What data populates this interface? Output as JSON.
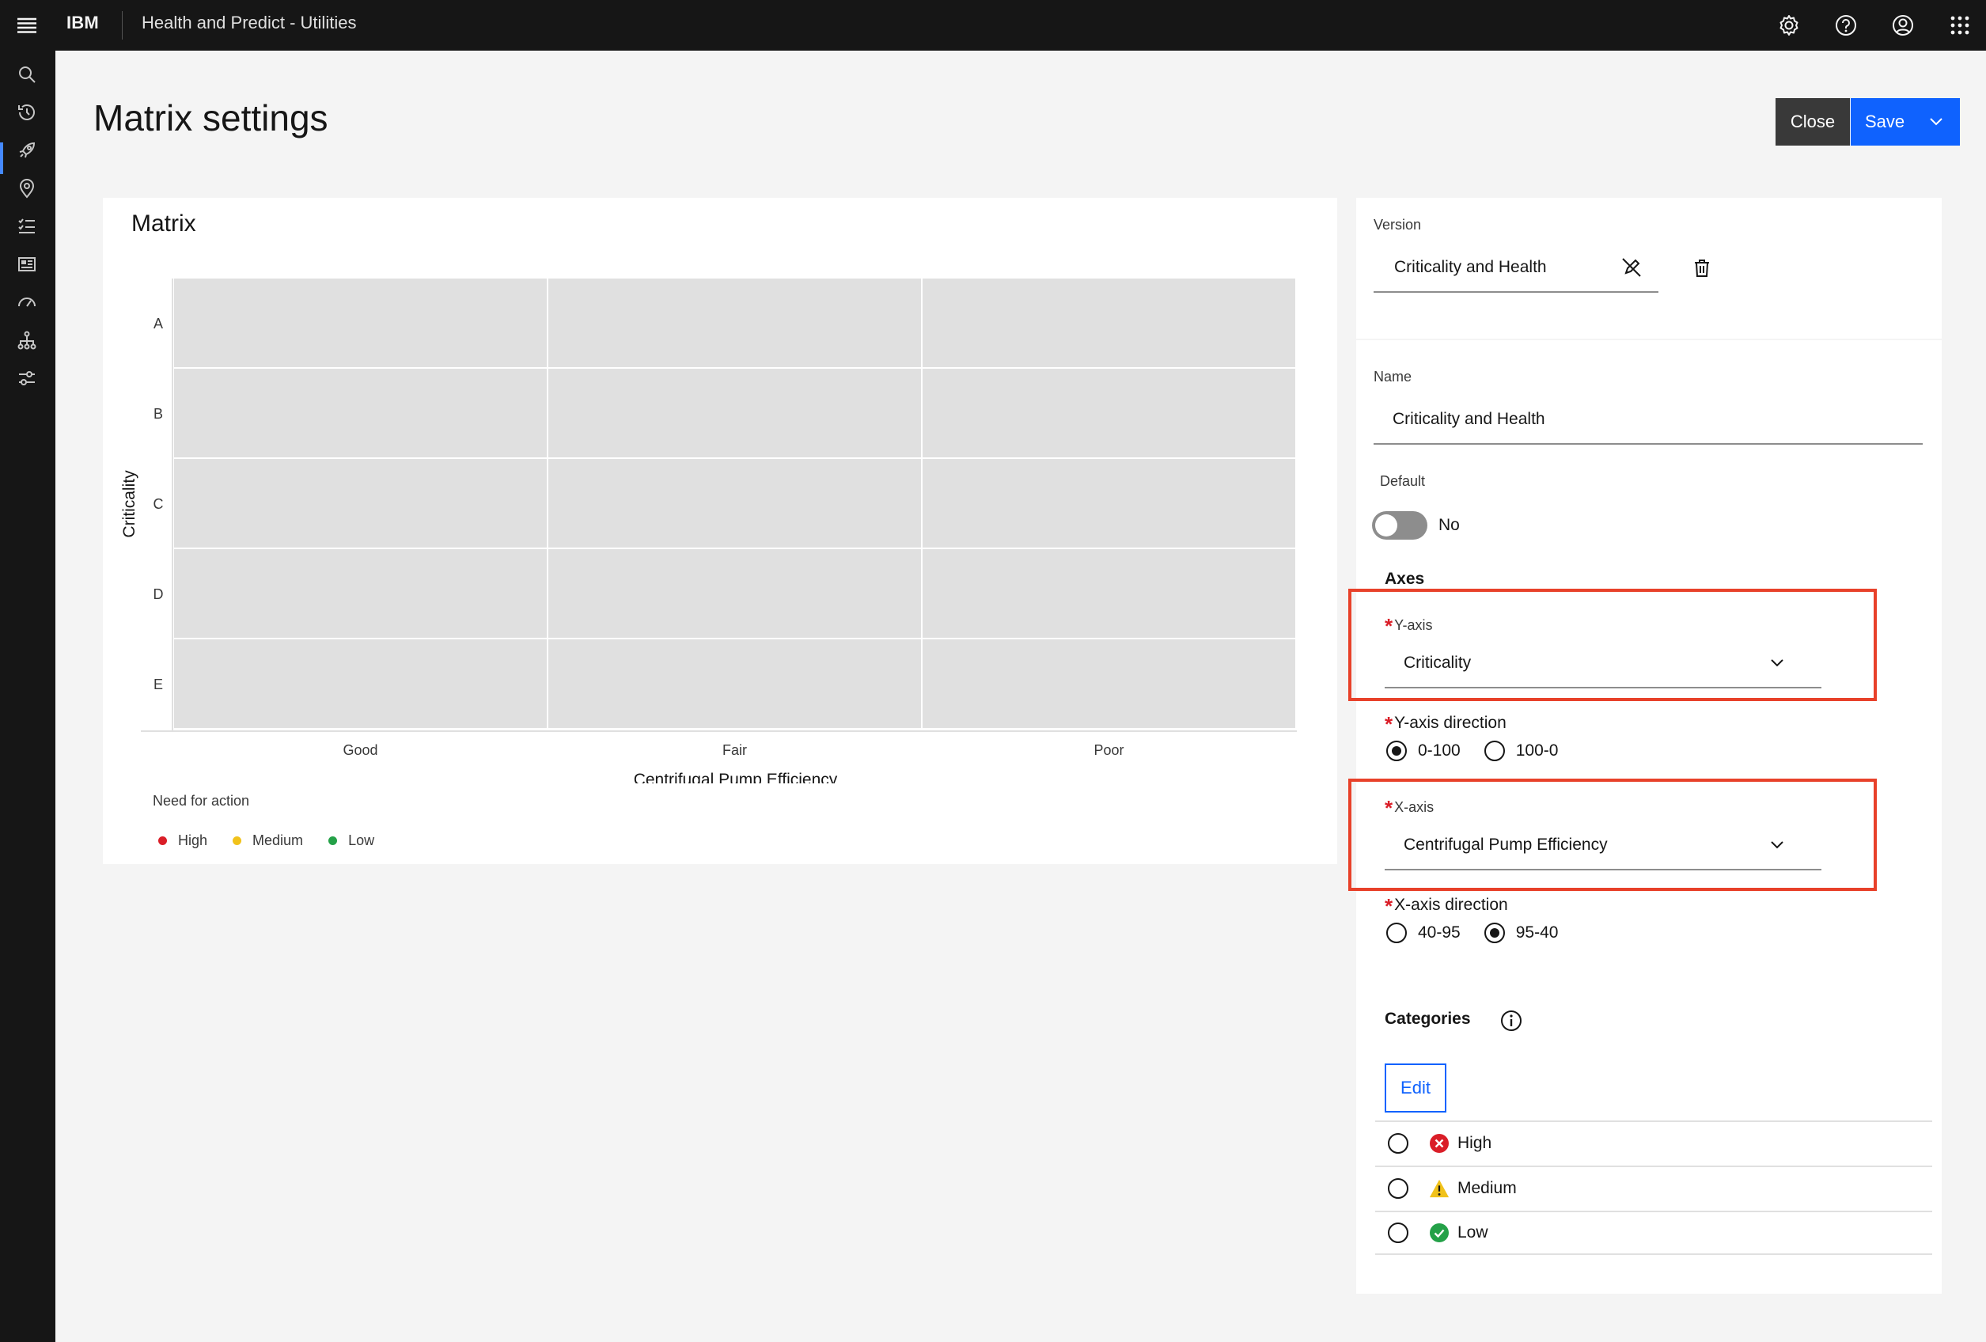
{
  "header": {
    "brand": "IBM",
    "app_name": "Health and Predict - Utilities",
    "icons": [
      "menu-icon",
      "settings-icon",
      "help-icon",
      "user-icon",
      "app-switcher-icon"
    ]
  },
  "left_nav": {
    "icons": [
      "search-icon",
      "history-icon",
      "rocket-icon",
      "location-icon",
      "checklist-icon",
      "dashboard-icon",
      "gauge-icon",
      "hierarchy-icon",
      "sliders-icon"
    ],
    "active_index": 2
  },
  "page": {
    "title": "Matrix settings",
    "close_label": "Close",
    "save_label": "Save"
  },
  "matrix": {
    "title": "Matrix",
    "legend_title": "Need for action",
    "legend": [
      {
        "label": "High",
        "color": "#da1e28"
      },
      {
        "label": "Medium",
        "color": "#f1c21b"
      },
      {
        "label": "Low",
        "color": "#24a148"
      }
    ]
  },
  "chart_data": {
    "type": "heatmap",
    "title": "Matrix",
    "xlabel": "Centrifugal Pump Efficiency",
    "ylabel": "Criticality",
    "x_categories": [
      "Good",
      "Fair",
      "Poor"
    ],
    "y_categories": [
      "A",
      "B",
      "C",
      "D",
      "E"
    ],
    "cell_color": "#e0e0e0",
    "values": []
  },
  "settings": {
    "version_label": "Version",
    "version_value": "Criticality and Health",
    "name_label": "Name",
    "name_value": "Criticality and Health",
    "default_label": "Default",
    "default_value": "No",
    "axes_heading": "Axes",
    "y_axis_label": "Y-axis",
    "y_axis_value": "Criticality",
    "y_direction_label": "Y-axis direction",
    "y_direction_options": [
      "0-100",
      "100-0"
    ],
    "y_direction_selected": "0-100",
    "x_axis_label": "X-axis",
    "x_axis_value": "Centrifugal Pump Efficiency",
    "x_direction_label": "X-axis direction",
    "x_direction_options": [
      "40-95",
      "95-40"
    ],
    "x_direction_selected": "95-40",
    "categories_heading": "Categories",
    "edit_label": "Edit",
    "categories": [
      {
        "label": "High",
        "icon": "error-icon",
        "color": "#da1e28"
      },
      {
        "label": "Medium",
        "icon": "warning-icon",
        "color": "#f1c21b"
      },
      {
        "label": "Low",
        "icon": "checkmark-icon",
        "color": "#24a148"
      }
    ]
  }
}
